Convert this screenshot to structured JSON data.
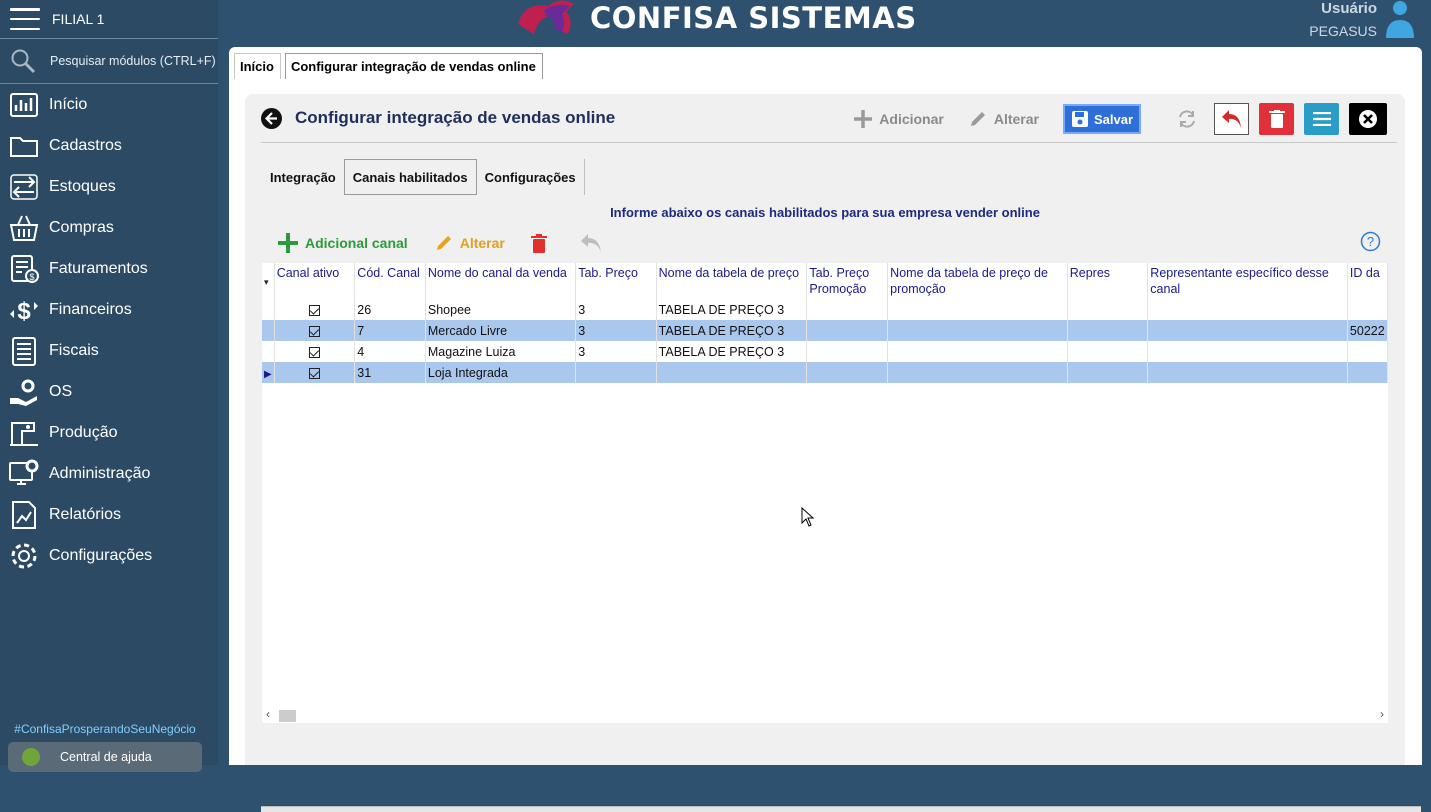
{
  "sidebar": {
    "filial": "FILIAL 1",
    "search_placeholder": "Pesquisar módulos (CTRL+F)",
    "items": [
      {
        "label": "Início",
        "icon": "chart-icon"
      },
      {
        "label": "Cadastros",
        "icon": "folder-icon"
      },
      {
        "label": "Estoques",
        "icon": "transfer-icon"
      },
      {
        "label": "Compras",
        "icon": "basket-icon"
      },
      {
        "label": "Faturamentos",
        "icon": "invoice-dollar-icon"
      },
      {
        "label": "Financeiros",
        "icon": "dollar-arrows-icon"
      },
      {
        "label": "Fiscais",
        "icon": "document-list-icon"
      },
      {
        "label": "OS",
        "icon": "hand-gear-icon"
      },
      {
        "label": "Produção",
        "icon": "sewing-icon"
      },
      {
        "label": "Administração",
        "icon": "monitor-gear-icon"
      },
      {
        "label": "Relatórios",
        "icon": "report-chart-icon"
      },
      {
        "label": "Configurações",
        "icon": "gear-icon"
      }
    ],
    "hashtag": "#ConfisaProsperandoSeuNegócio",
    "help": "Central de ajuda"
  },
  "header": {
    "brand": "CONFISA SISTEMAS",
    "user_label": "Usuário",
    "user_name": "PEGASUS"
  },
  "tabs": [
    {
      "label": "Início"
    },
    {
      "label": "Configurar integração de vendas online"
    }
  ],
  "panel": {
    "title": "Configurar integração de vendas online",
    "toolbar": {
      "add": "Adicionar",
      "edit": "Alterar",
      "save": "Salvar"
    },
    "subtabs": [
      {
        "label": "Integração"
      },
      {
        "label": "Canais habilitados"
      },
      {
        "label": "Configurações"
      }
    ],
    "info": "Informe abaixo os canais habilitados para sua empresa vender online",
    "grid_toolbar": {
      "add": "Adicional canal",
      "edit": "Alterar"
    }
  },
  "grid": {
    "headers": [
      "Canal ativo",
      "Cód. Canal",
      "Nome do canal da venda",
      "Tab. Preço",
      "Nome da tabela de preço",
      "Tab. Preço Promoção",
      "Nome da tabela de preço de promoção",
      "Repres",
      "Representante específico desse canal",
      "ID da"
    ],
    "rows": [
      {
        "active": true,
        "code": "26",
        "name": "Shopee",
        "tab": "3",
        "tabname": "TABELA DE PREÇO 3",
        "id": ""
      },
      {
        "active": true,
        "code": "7",
        "name": "Mercado Livre",
        "tab": "3",
        "tabname": "TABELA DE PREÇO 3",
        "id": "50222"
      },
      {
        "active": true,
        "code": "4",
        "name": "Magazine Luiza",
        "tab": "3",
        "tabname": "TABELA DE PREÇO 3",
        "id": ""
      },
      {
        "active": true,
        "code": "31",
        "name": "Loja Integrada",
        "tab": "",
        "tabname": "",
        "id": ""
      }
    ]
  }
}
